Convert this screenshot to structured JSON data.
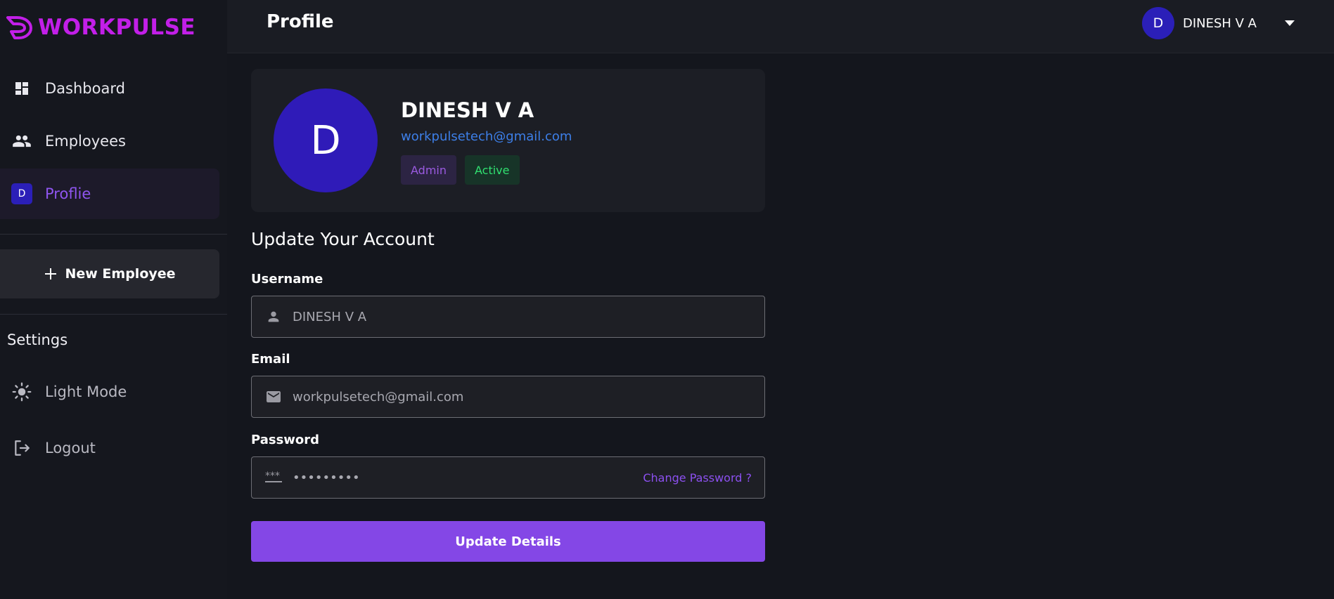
{
  "app": {
    "brand": "WORKPULSE"
  },
  "sidebar": {
    "items": [
      {
        "label": "Dashboard",
        "icon": "dashboard-icon"
      },
      {
        "label": "Employees",
        "icon": "people-icon"
      },
      {
        "label": "Proflie",
        "icon": "avatar-icon",
        "avatar_letter": "D",
        "active": true
      }
    ],
    "new_employee_label": "New Employee",
    "settings_title": "Settings",
    "light_mode_label": "Light Mode",
    "logout_label": "Logout"
  },
  "header": {
    "title": "Profile",
    "user_initial": "D",
    "user_name": "DINESH V A"
  },
  "profile": {
    "initial": "D",
    "name": "DINESH V A",
    "email": "workpulsetech@gmail.com",
    "badges": {
      "role": "Admin",
      "status": "Active"
    }
  },
  "form": {
    "title": "Update Your Account",
    "username_label": "Username",
    "username_value": "DINESH V A",
    "email_label": "Email",
    "email_value": "workpulsetech@gmail.com",
    "password_label": "Password",
    "password_value": "•••••••••",
    "change_password_label": "Change Password ?",
    "submit_label": "Update Details"
  },
  "colors": {
    "brand": "#c21fe8",
    "accent": "#8447e6",
    "avatar": "#2f1bb8",
    "email_link": "#3d7fe8",
    "status_active": "#30e070"
  }
}
